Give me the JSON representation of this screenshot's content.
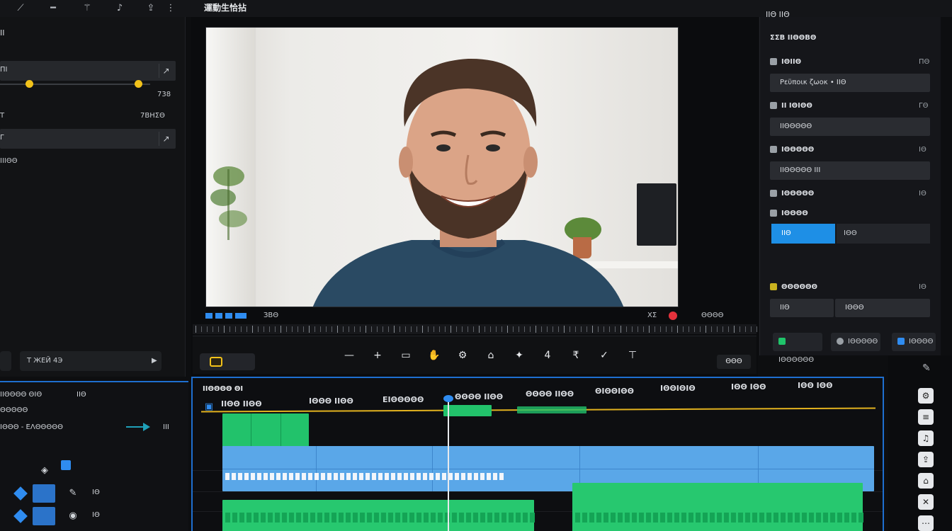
{
  "topbar": {
    "title": "運動生恰拈",
    "icons": [
      "brush-icon",
      "pen-icon",
      "magic-wand-icon",
      "music-note-icon",
      "export-icon",
      "more-vertical-icon"
    ]
  },
  "left_panel": {
    "header": "ΙΙ",
    "rows": [
      "ΠΙ",
      "Τ",
      "Γ"
    ],
    "row_values": [
      "738",
      "7ΒΗΣΘ"
    ],
    "row_buttons": [
      "↗",
      "↗"
    ],
    "label_bottom": "ΙΙΙΘΘ",
    "footer_buttons": [
      "Т ЖЕЙ 4Э",
      "▶"
    ]
  },
  "viewer": {
    "timecode_left": "ЗВΘ",
    "status_right": "ΧΣ",
    "record_label": "ΘΘΘΘ",
    "tools": [
      "—",
      "+",
      "▭",
      "✋",
      "⚙",
      "⌂",
      "✦",
      "4",
      "₹",
      "✓",
      "⊤"
    ],
    "output_button": "ΘΘΘ"
  },
  "right_panel": {
    "title": "ΙΙΘ ΙΙΘ",
    "header": "ΣΣΒ ΙΙΘΘΒΘ",
    "sections": [
      {
        "label": "ΙΘΙΙΘ",
        "value": "ΠΘ",
        "field": "Ρεϋποικ ζωοκ • ΙΙΘ"
      },
      {
        "label": "ΙΙ ΙΘΙΘΘ",
        "value": "ΓΘ",
        "field": "ΙΙΘΘΘΘΘ"
      },
      {
        "label": "ΙΘΘΘΘΘ",
        "value": "ΙΘ",
        "field": "ΙΙΘΘΘΘΘ ΙΙΙ"
      },
      {
        "label": "ΙΘΘΘΘΘ",
        "value": "ΙΘ",
        "field": ""
      },
      {
        "label": "ΙΘΘΘΘ",
        "value": "",
        "field": ""
      }
    ],
    "blue_button": "ΙΙΘ",
    "blue_value": "ΙΘΘ",
    "section_bottom": {
      "label": "ΘΘΘΘΘΘ",
      "value": "ΙΘ",
      "field_left": "ΙΙΘ",
      "field_right": "ΙΘΘΘ"
    },
    "bottom_buttons": [
      "ΙΘΘΘΘΘΘ",
      "ΙΘΘΘΘΘ",
      "ΙΘΘΘΘ"
    ],
    "colors": {
      "green": "#1fc46a",
      "gray": "#9aa0a6",
      "blue": "#2f8cf0"
    }
  },
  "track_headers": {
    "top_labels": [
      "ΙΙΘΘΘΘ ΘΙΘ",
      "ΙΙΘ"
    ],
    "row1": "ΘΘΘΘΘ",
    "row2_left": "ΙΘΘΘ - ΕΛΘΘΘΘΘ",
    "row2_right": "ΙΙΙ",
    "track_labels": [
      "ΙΘ",
      "ΙΘ"
    ]
  },
  "timeline": {
    "title": "ΙΙΘΘΘΘ ΘΙ",
    "ruler_labels": [
      "ΙΙΘΘ ΙΙΘΘ",
      "ΙΘΘΘ ΙΙΘΘ",
      "ΕΙΘΘΘΘΘ",
      "ΘΘΘΘ ΙΙΘΘ",
      "ΘΘΘΘ ΙΙΘΘ",
      "ΘΙΘΘΙΘΘ",
      "ΙΘΘΙΘΙΘ",
      "ΙΘΘ ΙΘΘ",
      "ΙΘΘ ΙΘΘ"
    ],
    "colors": {
      "playhead": "#e8eaed",
      "ruler": "#e2b21f",
      "green": "#1fc46a",
      "blue": "#5aa7e8",
      "frame": "#1e6fd0"
    }
  }
}
